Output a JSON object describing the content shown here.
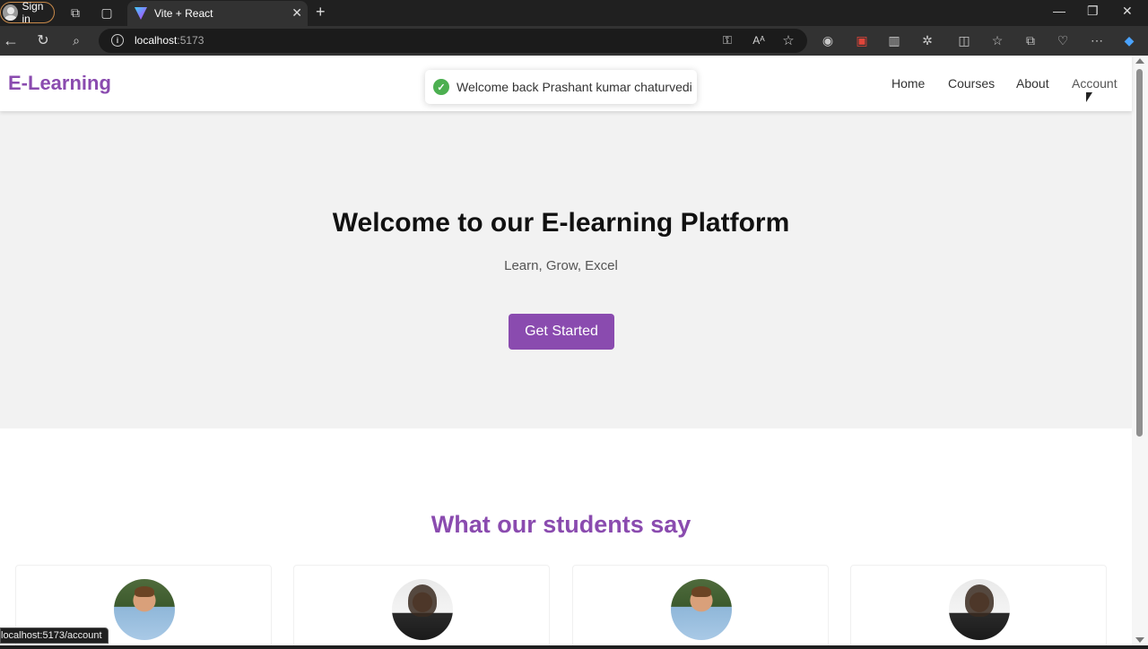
{
  "browser": {
    "signin_label": "Sign in",
    "tab_title": "Vite + React",
    "url_host": "localhost",
    "url_port": ":5173",
    "status_url": "localhost:5173/account"
  },
  "navbar": {
    "brand": "E-Learning",
    "links": [
      "Home",
      "Courses",
      "About",
      "Account"
    ]
  },
  "toast": {
    "message": "Welcome back Prashant kumar chaturvedi"
  },
  "hero": {
    "title": "Welcome to our E-learning Platform",
    "subtitle": "Learn, Grow, Excel",
    "cta": "Get Started"
  },
  "testimonials": {
    "title": "What our students say"
  },
  "colors": {
    "accent": "#8a4baf",
    "hero_bg": "#f2f2f2",
    "toast_success": "#4caf50"
  }
}
